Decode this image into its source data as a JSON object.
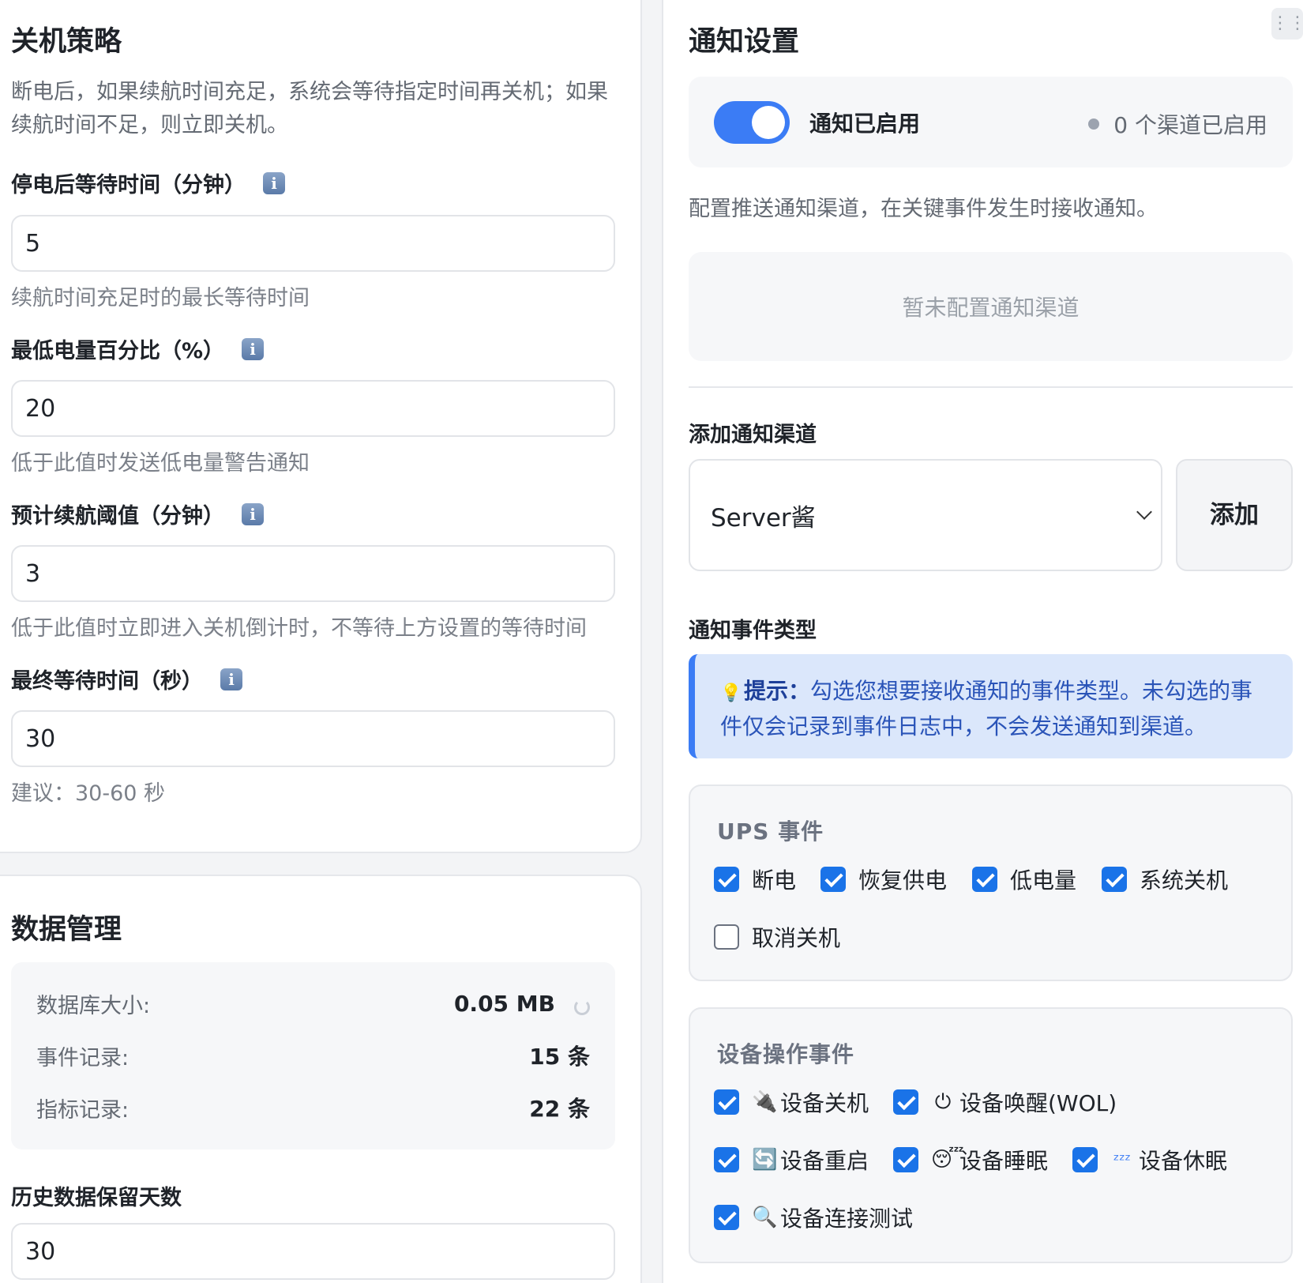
{
  "shutdown": {
    "title": "关机策略",
    "description": "断电后，如果续航时间充足，系统会等待指定时间再关机；如果续航时间不足，则立即关机。",
    "fields": [
      {
        "label": "停电后等待时间（分钟）",
        "value": "5",
        "help": "续航时间充足时的最长等待时间"
      },
      {
        "label": "最低电量百分比（%）",
        "value": "20",
        "help": "低于此值时发送低电量警告通知"
      },
      {
        "label": "预计续航阈值（分钟）",
        "value": "3",
        "help": "低于此值时立即进入关机倒计时，不等待上方设置的等待时间"
      },
      {
        "label": "最终等待时间（秒）",
        "value": "30",
        "help": "建议：30-60 秒"
      }
    ],
    "info_icon": "i"
  },
  "data_mgmt": {
    "title": "数据管理",
    "stats": [
      {
        "label": "数据库大小:",
        "value": "0.05 MB"
      },
      {
        "label": "事件记录:",
        "value": "15 条"
      },
      {
        "label": "指标记录:",
        "value": "22 条"
      }
    ],
    "retention_label": "历史数据保留天数",
    "retention_value": "30"
  },
  "notify": {
    "title": "通知设置",
    "toggle_label": "通知已启用",
    "toggle_on": true,
    "channel_count": "0 个渠道已启用",
    "description": "配置推送通知渠道，在关键事件发生时接收通知。",
    "empty_text": "暂未配置通知渠道",
    "add_channel_label": "添加通知渠道",
    "selected_channel": "Server酱",
    "add_button": "添加",
    "event_types_label": "通知事件类型",
    "hint_prefix": "提示：",
    "hint_text": "勾选您想要接收通知的事件类型。未勾选的事件仅会记录到事件日志中，不会发送通知到渠道。",
    "ups_group": {
      "title": "UPS 事件",
      "items": [
        {
          "label": "断电",
          "checked": true
        },
        {
          "label": "恢复供电",
          "checked": true
        },
        {
          "label": "低电量",
          "checked": true
        },
        {
          "label": "系统关机",
          "checked": true
        },
        {
          "label": "取消关机",
          "checked": false
        }
      ]
    },
    "device_group": {
      "title": "设备操作事件",
      "items": [
        {
          "icon": "plug-icon",
          "glyph": "🔌",
          "label": "设备关机",
          "checked": true
        },
        {
          "icon": "power-icon",
          "glyph": "⏻",
          "label": "设备唤醒(WOL)",
          "checked": true
        },
        {
          "icon": "restart-icon",
          "glyph": "🔄",
          "label": "设备重启",
          "checked": true
        },
        {
          "icon": "sleepy-face-icon",
          "glyph": "😴",
          "label": "设备睡眠",
          "checked": true
        },
        {
          "icon": "zzz-icon",
          "glyph": "ᶻᶻᶻ",
          "label": "设备休眠",
          "checked": true
        },
        {
          "icon": "magnifier-icon",
          "glyph": "🔍",
          "label": "设备连接测试",
          "checked": true
        }
      ]
    }
  },
  "colors": {
    "accent": "#3b7cf5",
    "checkbox": "#1a73e8",
    "hint_bg": "#dbe7fb"
  }
}
